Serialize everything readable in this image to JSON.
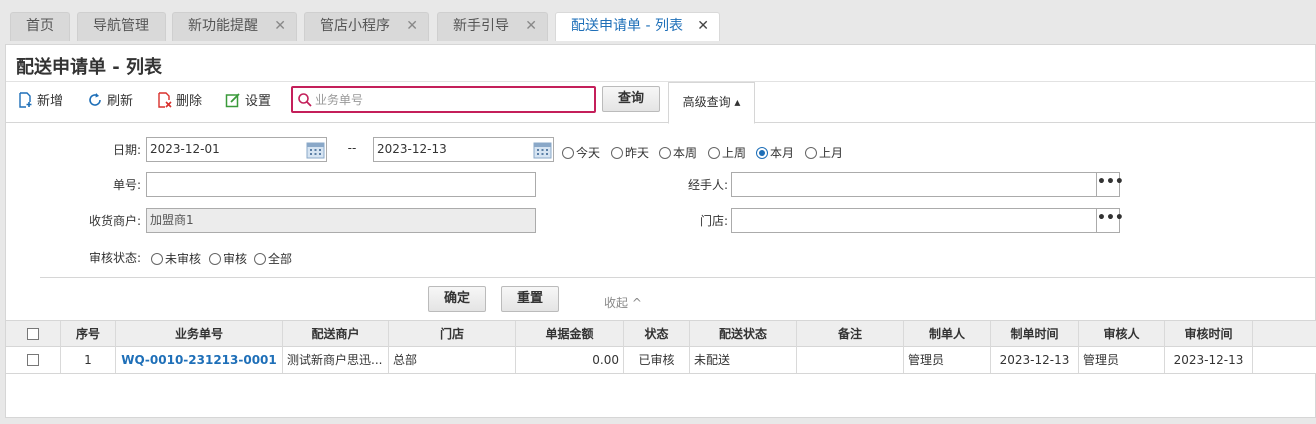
{
  "tabs": [
    {
      "label": "首页",
      "closable": false
    },
    {
      "label": "导航管理",
      "closable": false
    },
    {
      "label": "新功能提醒",
      "closable": true
    },
    {
      "label": "管店小程序",
      "closable": true
    },
    {
      "label": "新手引导",
      "closable": true
    },
    {
      "label": "配送申请单 - 列表",
      "closable": true,
      "active": true
    }
  ],
  "close_glyph": "✕",
  "page_title": "配送申请单 - 列表",
  "toolbar": {
    "new_label": "新增",
    "refresh_label": "刷新",
    "delete_label": "删除",
    "settings_label": "设置",
    "search_placeholder": "业务单号",
    "search_value": "",
    "query_label": "查询",
    "advanced_label": "高级查询 ▴"
  },
  "filters": {
    "date_label": "日期:",
    "date_from": "2023-12-01",
    "date_sep": "--",
    "date_to": "2023-12-13",
    "date_presets": [
      {
        "label": "今天",
        "checked": false
      },
      {
        "label": "昨天",
        "checked": false
      },
      {
        "label": "本周",
        "checked": false
      },
      {
        "label": "上周",
        "checked": false
      },
      {
        "label": "本月",
        "checked": true
      },
      {
        "label": "上月",
        "checked": false
      }
    ],
    "doc_no_label": "单号:",
    "doc_no_value": "",
    "handler_label": "经手人:",
    "handler_value": "",
    "merchant_label": "收货商户:",
    "merchant_value": "加盟商1",
    "store_label": "门店:",
    "store_value": "",
    "audit_label": "审核状态:",
    "audit_options": [
      {
        "label": "未审核",
        "checked": false
      },
      {
        "label": "审核",
        "checked": false
      },
      {
        "label": "全部",
        "checked": false
      }
    ],
    "more_glyph": "•••",
    "confirm_label": "确定",
    "reset_label": "重置",
    "collapse_label": "收起 ^"
  },
  "table": {
    "headers": [
      "序号",
      "业务单号",
      "配送商户",
      "门店",
      "单据金额",
      "状态",
      "配送状态",
      "备注",
      "制单人",
      "制单时间",
      "审核人",
      "审核时间"
    ],
    "rows": [
      {
        "index": "1",
        "doc_no": "WQ-0010-231213-0001",
        "merchant": "测试新商户思迅...",
        "store": "总部",
        "amount": "0.00",
        "status": "已审核",
        "delivery_status": "未配送",
        "remark": "",
        "creator": "管理员",
        "created_at": "2023-12-13",
        "auditor": "管理员",
        "audited_at": "2023-12-13"
      }
    ]
  },
  "colors": {
    "accent": "#1e6fb8",
    "search_border": "#c41f5a",
    "delete_red": "#d9302c",
    "settings_green": "#3a9a3a"
  }
}
